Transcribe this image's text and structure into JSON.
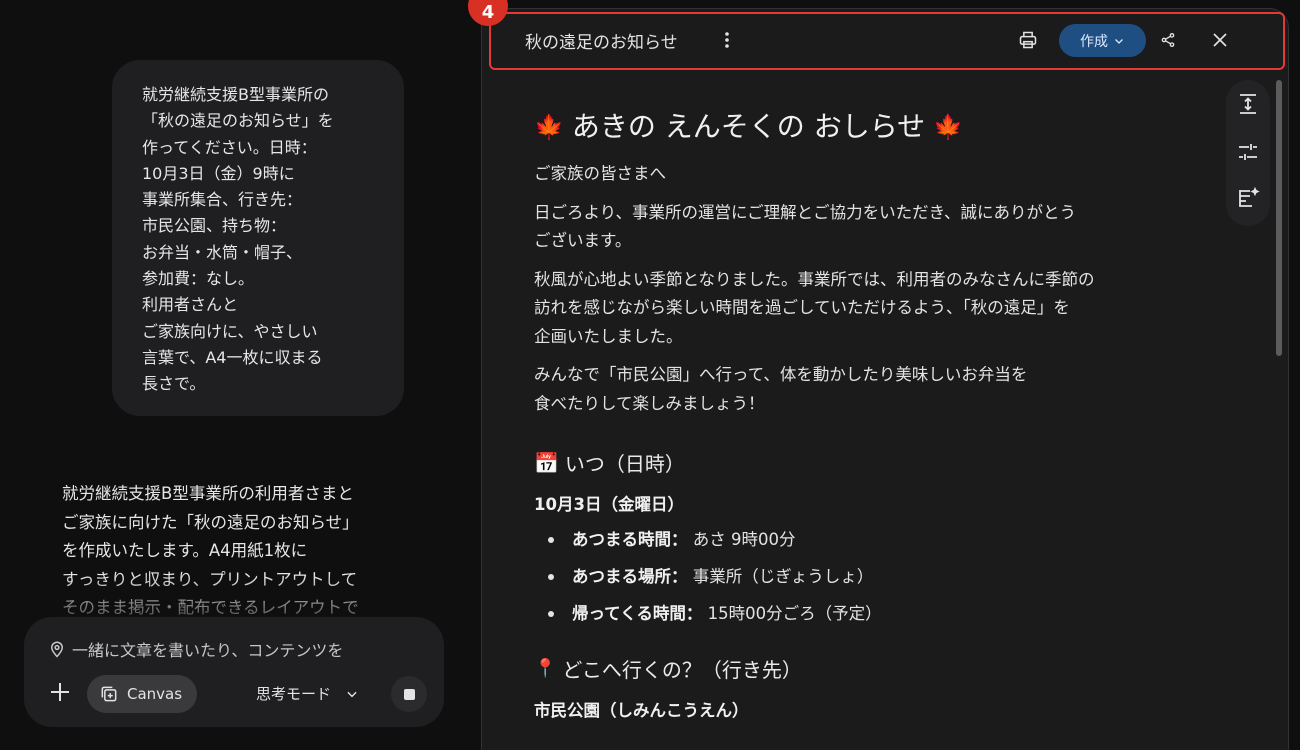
{
  "chat": {
    "user_message": "就労継続支援B型事業所の\n「秋の遠足のお知らせ」を\n作ってください。日時：\n10月3日（金）9時に\n事業所集合、行き先：\n市民公園、持ち物：\nお弁当・水筒・帽子、\n参加費：なし。\n利用者さんと\nご家族向けに、やさしい\n言葉で、A4一枚に収まる\n長さで。",
    "assistant_reply": "就労継続支援B型事業所の利用者さまと\nご家族に向けた「秋の遠足のお知らせ」\nを作成いたします。A4用紙1枚に\nすっきりと収まり、プリントアウトして\nそのまま掲示・配布できるレイアウトで"
  },
  "composer": {
    "placeholder": "一緒に文章を書いたり、コンテンツを",
    "canvas_label": "Canvas",
    "mode_label": "思考モード"
  },
  "toolbar": {
    "badge": "4",
    "doc_title": "秋の遠足のお知らせ",
    "create_label": "作成"
  },
  "document": {
    "heading": "あきの えんそくの おしらせ",
    "greeting": "ご家族の皆さまへ",
    "para1": "日ごろより、事業所の運営にご理解とご協力をいただき、誠にありがとう\nございます。",
    "para2": "秋風が心地よい季節となりました。事業所では、利用者のみなさんに季節の\n訪れを感じながら楽しい時間を過ごしていただけるよう、「秋の遠足」を\n企画いたしました。",
    "para3": "みんなで「市民公園」へ行って、体を動かしたり美味しいお弁当を\n食べたりして楽しみましょう！",
    "section_when": "いつ（日時）",
    "date": "10月3日（金曜日）",
    "items": [
      {
        "label": "あつまる時間：",
        "value": "あさ 9時00分"
      },
      {
        "label": "あつまる場所：",
        "value": "事業所（じぎょうしょ）"
      },
      {
        "label": "帰ってくる時間：",
        "value": "15時00分ごろ（予定）"
      }
    ],
    "section_where": "どこへ行くの？（行き先）",
    "place": "市民公園（しみんこうえん）"
  },
  "colors": {
    "background": "#0f0f10",
    "panel": "#1b1b1c",
    "create_button": "#1f4f82",
    "highlight": "#e53935"
  }
}
